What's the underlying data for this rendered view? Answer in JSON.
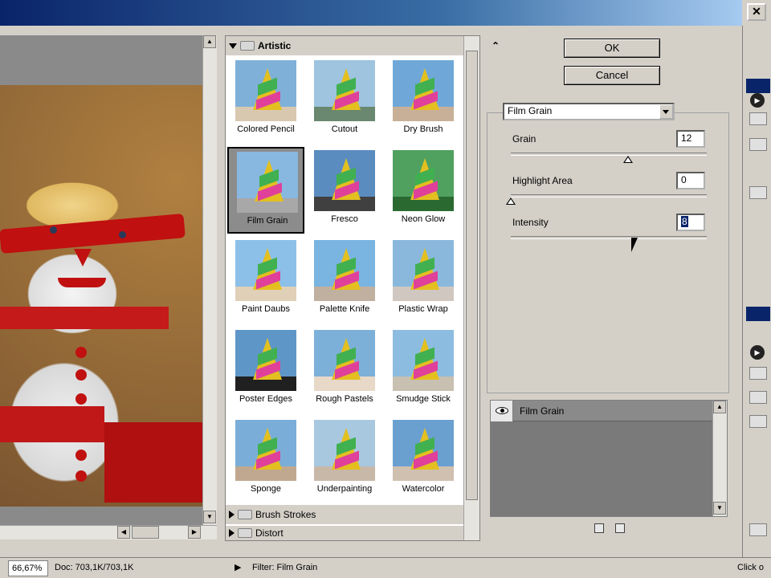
{
  "window": {
    "close_glyph": "✕"
  },
  "gallery": {
    "categories": [
      {
        "name": "Artistic",
        "expanded": true
      },
      {
        "name": "Brush Strokes",
        "expanded": false
      },
      {
        "name": "Distort",
        "expanded": false
      }
    ],
    "thumbnails": [
      {
        "label": "Colored Pencil",
        "selected": false
      },
      {
        "label": "Cutout",
        "selected": false
      },
      {
        "label": "Dry Brush",
        "selected": false
      },
      {
        "label": "Film Grain",
        "selected": true
      },
      {
        "label": "Fresco",
        "selected": false
      },
      {
        "label": "Neon Glow",
        "selected": false
      },
      {
        "label": "Paint Daubs",
        "selected": false
      },
      {
        "label": "Palette Knife",
        "selected": false
      },
      {
        "label": "Plastic Wrap",
        "selected": false
      },
      {
        "label": "Poster Edges",
        "selected": false
      },
      {
        "label": "Rough Pastels",
        "selected": false
      },
      {
        "label": "Smudge Stick",
        "selected": false
      },
      {
        "label": "Sponge",
        "selected": false
      },
      {
        "label": "Underpainting",
        "selected": false
      },
      {
        "label": "Watercolor",
        "selected": false
      }
    ]
  },
  "dialog": {
    "ok_label": "OK",
    "cancel_label": "Cancel",
    "collapse_glyph": "⌃",
    "filter_select": "Film Grain",
    "params": [
      {
        "label": "Grain",
        "value": "12",
        "slider_fraction": 0.6
      },
      {
        "label": "Highlight Area",
        "value": "0",
        "slider_fraction": 0.0
      },
      {
        "label": "Intensity",
        "value": "8",
        "slider_fraction": 0.6
      }
    ]
  },
  "layers": {
    "items": [
      {
        "name": "Film Grain",
        "visible": true
      }
    ]
  },
  "statusbar": {
    "zoom": "66,67%",
    "doc": "Doc: 703,1K/703,1K",
    "filter": "Filter: Film Grain",
    "right_text": "Click o"
  },
  "colors": {
    "title_start": "#0a246a",
    "title_end": "#a6caf0",
    "selection": "#0a246a",
    "panel": "#d4d0c8"
  }
}
